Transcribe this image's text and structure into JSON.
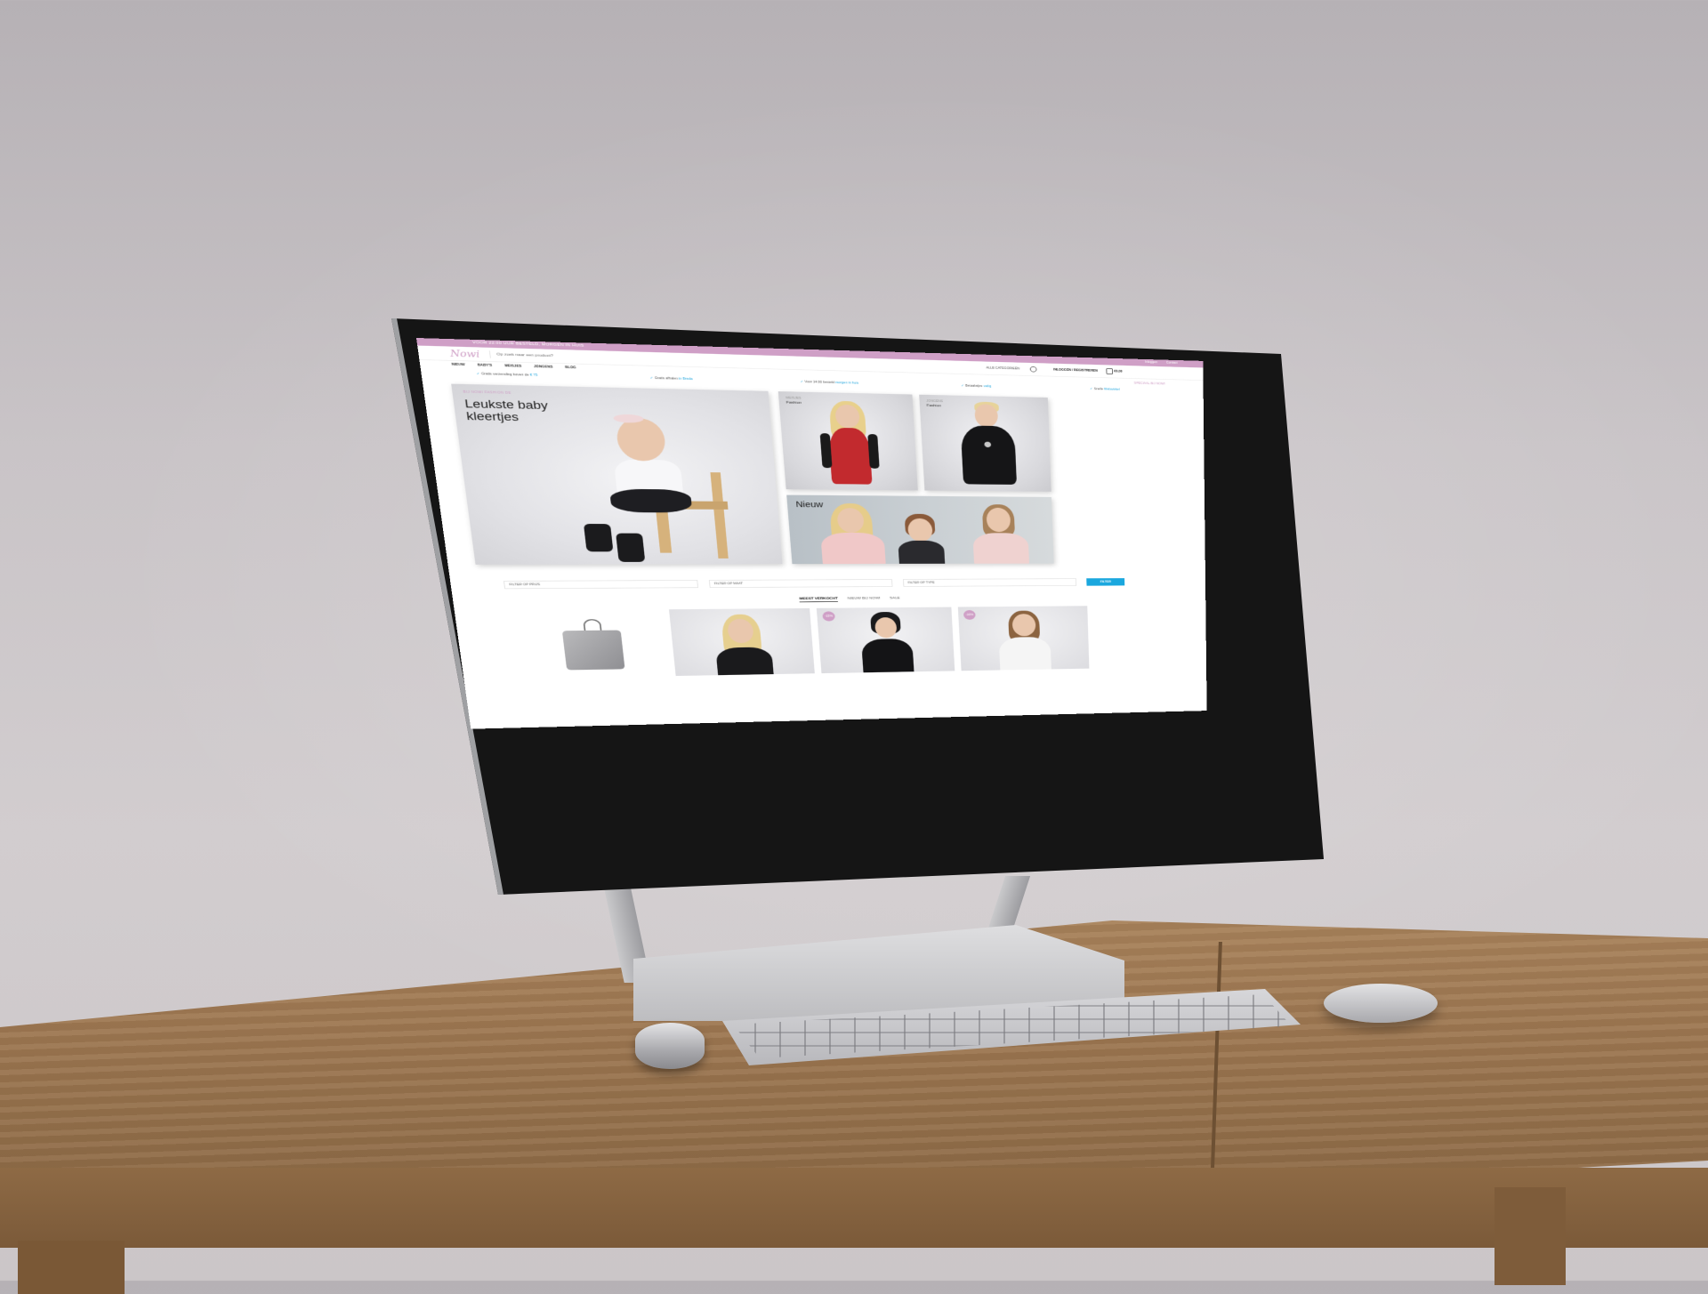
{
  "site": {
    "topbar_promo": "VOOR 22:00 UUR BESTELD, MORGEN IN HUIS",
    "topbar_links": [
      "Inloggen",
      "Contact"
    ],
    "logo": "Nowi",
    "search_placeholder": "Op zoek naar een product?",
    "category_select": "ALLE CATEGORIEËN",
    "login": "INLOGGEN / REGISTREREN",
    "cart_total": "€0,00",
    "nav": [
      "NIEUW",
      "BABY'S",
      "MEISJES",
      "JONGENS",
      "BLOG"
    ],
    "nav_right": "SPECIAAL BIJ NOWI",
    "usps": [
      {
        "text": "Gratis verzending boven de",
        "link": "€ 75"
      },
      {
        "text": "Gratis afhalen",
        "link": "in Breda"
      },
      {
        "text": "Voor 14:00 besteld",
        "link": "morgen in huis"
      },
      {
        "text": "Betaalwijze",
        "link": "veilig"
      },
      {
        "text": "Snelle",
        "link": "Webwinkel"
      }
    ]
  },
  "hero": {
    "eyebrow": "BIJ NOWI FASHION DE",
    "title": "Leukste baby kleertjes",
    "tiles": [
      {
        "eyebrow": "MEISJES",
        "label": "Fashion"
      },
      {
        "eyebrow": "JONGENS",
        "label": "Fashion"
      }
    ],
    "banner_title": "Nieuw"
  },
  "filters": {
    "items": [
      "FILTER OP PRIJS",
      "FILTER OP MAAT",
      "FILTER OP TYPE"
    ],
    "button": "FILTER"
  },
  "tabs": [
    "MEEST VERKOCHT",
    "NIEUW BIJ NOWI",
    "SALE"
  ],
  "products": {
    "badges": [
      "-15%",
      "-10%"
    ]
  },
  "colors": {
    "brand_pink": "#cf9fc6",
    "accent_blue": "#1aa7de",
    "wall": "#c9c4c7",
    "desk": "#9c7650"
  }
}
